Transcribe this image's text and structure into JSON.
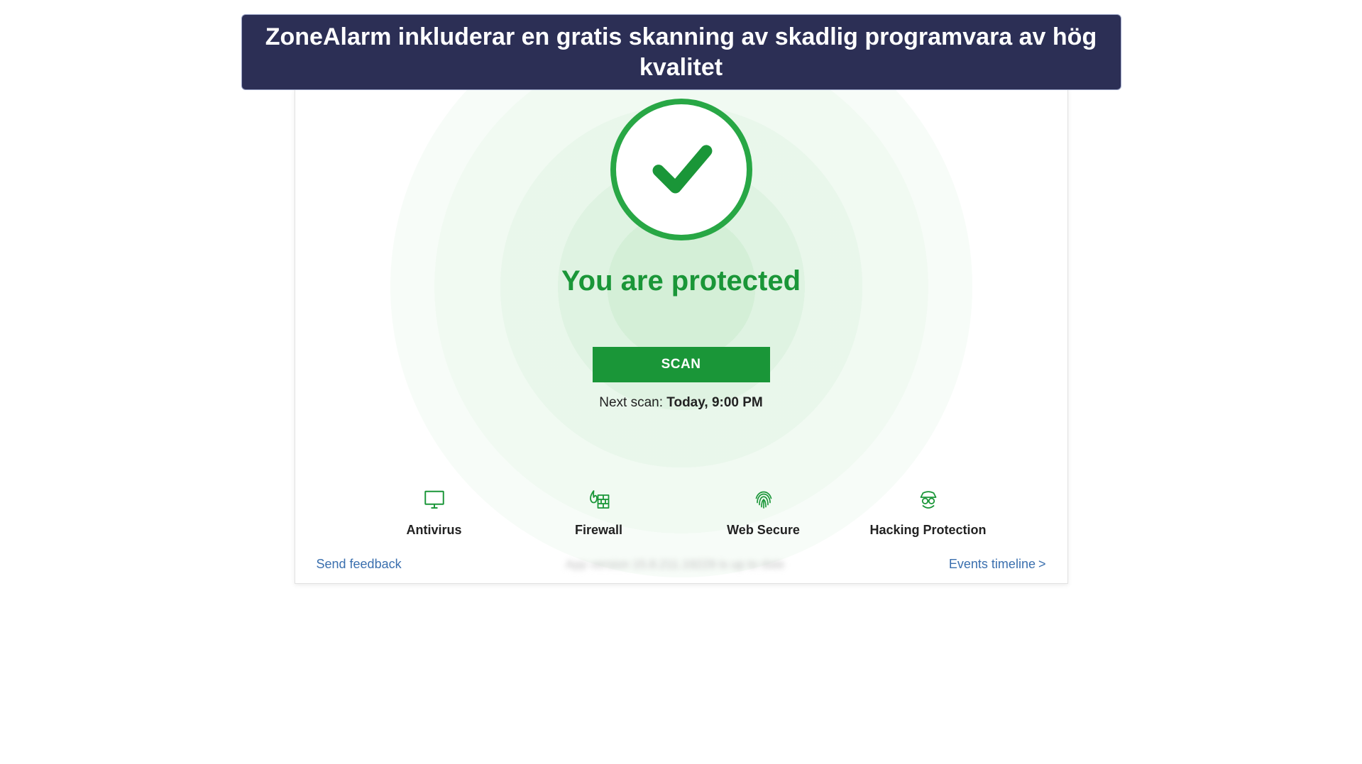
{
  "caption": "ZoneAlarm inkluderar en gratis skanning av skadlig programvara av hög kvalitet",
  "status": {
    "headline": "You are protected",
    "scan_button": "SCAN",
    "next_scan_label": "Next scan: ",
    "next_scan_value": "Today, 9:00 PM"
  },
  "nav": [
    {
      "label": "Antivirus",
      "icon": "monitor-icon"
    },
    {
      "label": "Firewall",
      "icon": "firewall-icon"
    },
    {
      "label": "Web Secure",
      "icon": "fingerprint-icon"
    },
    {
      "label": "Hacking Protection",
      "icon": "hacker-icon"
    }
  ],
  "footer": {
    "send_feedback": "Send feedback",
    "events_timeline": "Events timeline",
    "events_chevron": ">",
    "center_obscured": "App version 15.8.211.19229 is up to date"
  },
  "colors": {
    "accent_green": "#1a9638",
    "banner_bg": "#2c2f55",
    "link": "#3a6fae"
  }
}
